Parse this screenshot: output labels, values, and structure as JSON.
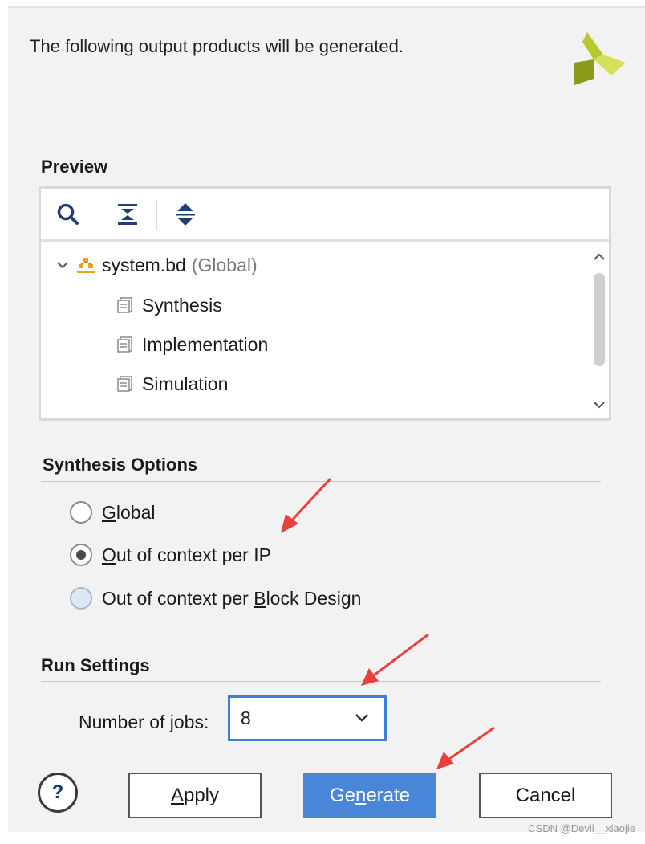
{
  "header": {
    "intro_text": "The following output products will be generated."
  },
  "preview": {
    "title": "Preview",
    "toolbar": {
      "search_icon": "search-icon",
      "collapse_icon": "collapse-all-icon",
      "expand_icon": "expand-all-icon"
    },
    "tree": {
      "root_label": "system.bd",
      "root_scope": "(Global)",
      "children": [
        "Synthesis",
        "Implementation",
        "Simulation"
      ]
    }
  },
  "synthesis_options": {
    "title": "Synthesis Options",
    "options": [
      {
        "pre": "",
        "key": "G",
        "post": "lobal",
        "selected": false
      },
      {
        "pre": "",
        "key": "O",
        "post": "ut of context per IP",
        "selected": true
      },
      {
        "pre": "Out of context per ",
        "key": "B",
        "post": "lock Design",
        "selected": false
      }
    ]
  },
  "run_settings": {
    "title": "Run Settings",
    "jobs_label_pre": "Number of ",
    "jobs_label_key": "j",
    "jobs_label_post": "obs:",
    "jobs_value": "8"
  },
  "buttons": {
    "help": "?",
    "apply_key": "A",
    "apply_rest": "pply",
    "generate_pre": "Ge",
    "generate_key": "n",
    "generate_post": "erate",
    "cancel": "Cancel"
  },
  "colors": {
    "accent": "#4a86d8",
    "annotation_arrow": "#e8403a",
    "logo_dark": "#7a8a14",
    "logo_light": "#c8d94a"
  },
  "watermark": "CSDN @Devil__xiaojie"
}
